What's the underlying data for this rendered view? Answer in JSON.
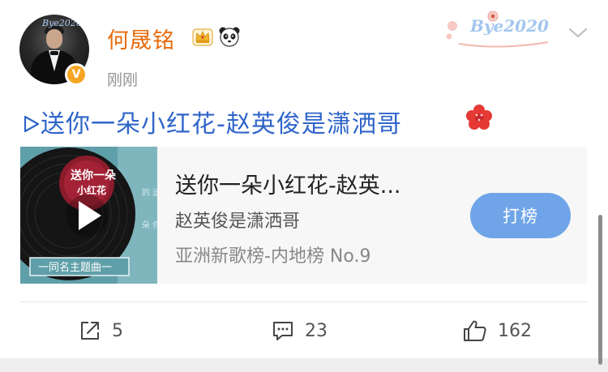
{
  "post": {
    "author": "何晟铭",
    "time": "刚刚",
    "badge": "V",
    "avatar_caption": "Bye2020",
    "decoration_text": "Bye2020",
    "text": "送你一朵小红花-赵英俊是潇洒哥"
  },
  "music_card": {
    "title": "送你一朵小红花-赵英...",
    "artist": "赵英俊是潇洒哥",
    "chart_rank": "亚洲新歌榜-内地榜 No.9",
    "action_label": "打榜",
    "cover_title": "送你一朵小红花",
    "cover_footer": "一同名主题曲一"
  },
  "actions": {
    "share_count": "5",
    "comment_count": "23",
    "like_count": "162"
  },
  "colors": {
    "author": "#e86b0c",
    "link": "#2f65c9",
    "button": "#6fa4e8",
    "badge": "#f6a623"
  },
  "icons": [
    "crown-icon",
    "panda-icon",
    "chevron-down-icon",
    "play-icon",
    "red-flower-icon",
    "share-icon",
    "comment-icon",
    "like-icon"
  ]
}
